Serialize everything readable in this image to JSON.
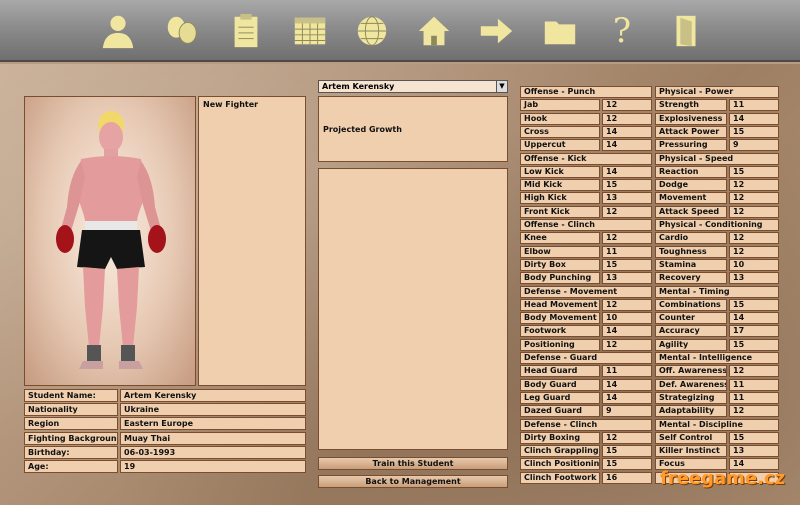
{
  "toolbar": {
    "icons": [
      "person-icon",
      "boxing-gloves-icon",
      "clipboard-icon",
      "calendar-icon",
      "globe-icon",
      "home-icon",
      "arrow-right-icon",
      "folder-icon",
      "help-icon",
      "exit-door-icon"
    ],
    "help_glyph": "?"
  },
  "profile": {
    "new_fighter": "New Fighter",
    "rows": [
      {
        "label": "Student Name:",
        "value": "Artem Kerensky"
      },
      {
        "label": "Nationality",
        "value": "Ukraine"
      },
      {
        "label": "Region",
        "value": "Eastern Europe"
      },
      {
        "label": "Fighting Background:",
        "value": "Muay Thai"
      },
      {
        "label": "Birthday:",
        "value": "06-03-1993"
      },
      {
        "label": "Age:",
        "value": "19"
      }
    ]
  },
  "student_select": {
    "value": "Artem Kerensky",
    "arrow": "▼"
  },
  "growth": {
    "label": "Projected Growth"
  },
  "buttons": {
    "train": "Train this Student",
    "back": "Back to Management"
  },
  "stats_left": [
    {
      "group": "Offense - Punch",
      "items": [
        [
          "Jab",
          "12"
        ],
        [
          "Hook",
          "12"
        ],
        [
          "Cross",
          "14"
        ],
        [
          "Uppercut",
          "14"
        ]
      ]
    },
    {
      "group": "Offense - Kick",
      "items": [
        [
          "Low Kick",
          "14"
        ],
        [
          "Mid Kick",
          "15"
        ],
        [
          "High Kick",
          "13"
        ],
        [
          "Front Kick",
          "12"
        ]
      ]
    },
    {
      "group": "Offense - Clinch",
      "items": [
        [
          "Knee",
          "12"
        ],
        [
          "Elbow",
          "11"
        ],
        [
          "Dirty Box",
          "15"
        ],
        [
          "Body Punching",
          "13"
        ]
      ]
    },
    {
      "group": "Defense - Movement",
      "items": [
        [
          "Head Movement",
          "12"
        ],
        [
          "Body Movement",
          "10"
        ],
        [
          "Footwork",
          "14"
        ],
        [
          "Positioning",
          "12"
        ]
      ]
    },
    {
      "group": "Defense - Guard",
      "items": [
        [
          "Head Guard",
          "11"
        ],
        [
          "Body Guard",
          "14"
        ],
        [
          "Leg Guard",
          "14"
        ],
        [
          "Dazed Guard",
          "9"
        ]
      ]
    },
    {
      "group": "Defense - Clinch",
      "items": [
        [
          "Dirty Boxing",
          "12"
        ],
        [
          "Clinch Grappling",
          "15"
        ],
        [
          "Clinch Positioning",
          "15"
        ],
        [
          "Clinch Footwork",
          "16"
        ]
      ]
    }
  ],
  "stats_right": [
    {
      "group": "Physical - Power",
      "items": [
        [
          "Strength",
          "11"
        ],
        [
          "Explosiveness",
          "14"
        ],
        [
          "Attack Power",
          "15"
        ],
        [
          "Pressuring",
          "9"
        ]
      ]
    },
    {
      "group": "Physical - Speed",
      "items": [
        [
          "Reaction",
          "15"
        ],
        [
          "Dodge",
          "12"
        ],
        [
          "Movement",
          "12"
        ],
        [
          "Attack Speed",
          "12"
        ]
      ]
    },
    {
      "group": "Physical - Conditioning",
      "items": [
        [
          "Cardio",
          "12"
        ],
        [
          "Toughness",
          "12"
        ],
        [
          "Stamina",
          "10"
        ],
        [
          "Recovery",
          "13"
        ]
      ]
    },
    {
      "group": "Mental - Timing",
      "items": [
        [
          "Combinations",
          "15"
        ],
        [
          "Counter",
          "14"
        ],
        [
          "Accuracy",
          "17"
        ],
        [
          "Agility",
          "15"
        ]
      ]
    },
    {
      "group": "Mental - Intelligence",
      "items": [
        [
          "Off. Awareness",
          "12"
        ],
        [
          "Def. Awareness",
          "11"
        ],
        [
          "Strategizing",
          "11"
        ],
        [
          "Adaptability",
          "12"
        ]
      ]
    },
    {
      "group": "Mental - Discipline",
      "items": [
        [
          "Self Control",
          "15"
        ],
        [
          "Killer Instinct",
          "13"
        ],
        [
          "Focus",
          "14"
        ],
        [
          "",
          ""
        ]
      ]
    }
  ],
  "watermark": "freegame.cz"
}
